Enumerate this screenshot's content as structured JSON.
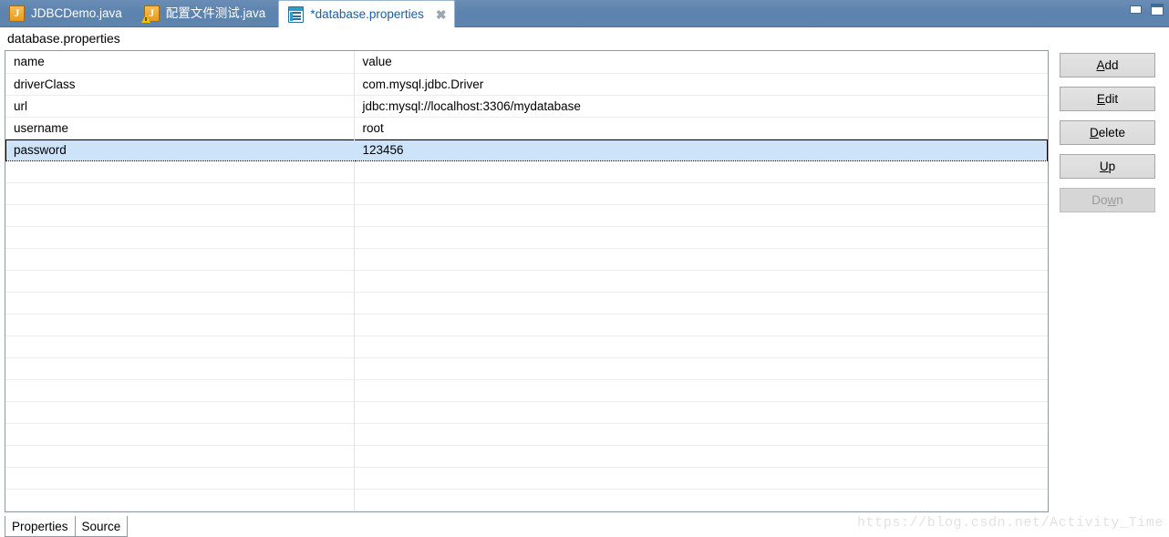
{
  "window": {
    "minimize_label": "minimize",
    "maximize_label": "maximize",
    "titlebar_color": "#5b83ae"
  },
  "editor_tabs": [
    {
      "label": "JDBCDemo.java",
      "icon": "java-file-icon",
      "active": false,
      "dirty": false,
      "closable": false
    },
    {
      "label": "配置文件测试.java",
      "icon": "java-file-warning-icon",
      "active": false,
      "dirty": false,
      "closable": false
    },
    {
      "label": "*database.properties",
      "icon": "properties-file-icon",
      "active": true,
      "dirty": true,
      "closable": true,
      "close_glyph": "✖"
    }
  ],
  "form": {
    "title": "database.properties"
  },
  "table": {
    "columns": [
      "name",
      "value"
    ],
    "rows": [
      {
        "name": "driverClass",
        "value": "com.mysql.jdbc.Driver",
        "selected": false
      },
      {
        "name": "url",
        "value": "jdbc:mysql://localhost:3306/mydatabase",
        "selected": false
      },
      {
        "name": "username",
        "value": "root",
        "selected": false
      },
      {
        "name": "password",
        "value": "123456",
        "selected": true
      }
    ],
    "empty_row_count": 16,
    "selection_color": "#cce3fa"
  },
  "buttons": [
    {
      "label": "Add",
      "mnemonic_index": 0,
      "enabled": true
    },
    {
      "label": "Edit",
      "mnemonic_index": 0,
      "enabled": true
    },
    {
      "label": "Delete",
      "mnemonic_index": 0,
      "enabled": true
    },
    {
      "label": "Up",
      "mnemonic_index": 0,
      "enabled": true
    },
    {
      "label": "Down",
      "mnemonic_index": 2,
      "enabled": false
    }
  ],
  "bottom_tabs": [
    {
      "label": "Properties",
      "active": true
    },
    {
      "label": "Source",
      "active": false
    }
  ],
  "watermark": "https://blog.csdn.net/Activity_Time"
}
